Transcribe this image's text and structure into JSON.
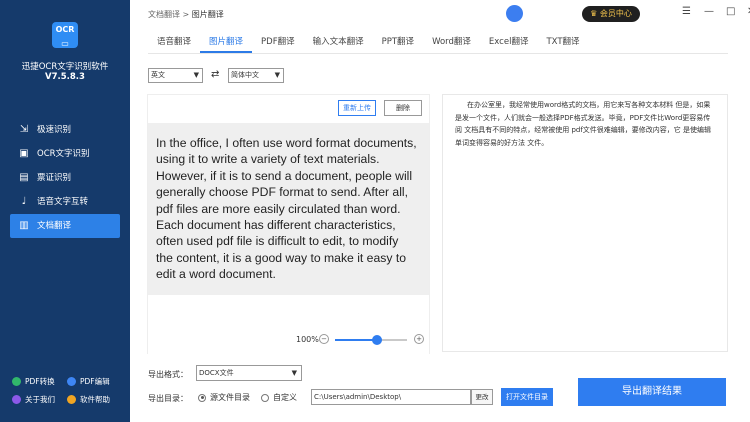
{
  "app": {
    "name": "迅捷OCR文字识别软件",
    "version": "V7.5.8.3"
  },
  "sidebar": {
    "items": [
      {
        "label": "极速识别",
        "icon": "speed-icon"
      },
      {
        "label": "OCR文字识别",
        "icon": "scan-icon"
      },
      {
        "label": "票证识别",
        "icon": "ticket-icon"
      },
      {
        "label": "语音文字互转",
        "icon": "mic-icon"
      },
      {
        "label": "文档翻译",
        "icon": "doc-icon"
      }
    ],
    "active_index": 4,
    "bottom": [
      "PDF转换",
      "PDF编辑",
      "关于我们",
      "软件帮助"
    ]
  },
  "topbar": {
    "breadcrumb": [
      "文档翻译",
      "图片翻译"
    ],
    "vip_label": "会员中心"
  },
  "tabs": [
    "语音翻译",
    "图片翻译",
    "PDF翻译",
    "输入文本翻译",
    "PPT翻译",
    "Word翻译",
    "Excel翻译",
    "TXT翻译"
  ],
  "active_tab": 1,
  "languages": {
    "source": "英文",
    "target": "简体中文"
  },
  "buttons": {
    "reupload": "重新上传",
    "delete": "删除",
    "change": "更改",
    "open_folder": "打开文件目录",
    "export": "导出翻译结果"
  },
  "source_text": "In the office, I often use word format documents, using it to write a variety of text materials. However, if it is to send a document, people will generally choose PDF format to send. After all, pdf files are more easily circulated than word. Each document has different characteristics, often used pdf file is difficult to edit, to modify the content, it is a good way to make it easy to edit a word document.",
  "target_text": "在办公室里，我经常使用word格式的文档，用它来写各种文本材料 但是，如果是发一个文件，人们就会一般选择PDF格式发送。毕竟，PDF文件比Word更容易传阅 文档具有不同的特点，经常被使用 pdf文件很难编辑，要修改内容，它 是使编辑单词变得容易的好方法 文件。",
  "zoom": {
    "label": "100%",
    "level": 0.58
  },
  "export": {
    "format_label": "导出格式：",
    "format_value": "DOCX文件",
    "dir_label": "导出目录：",
    "radio_source": "源文件目录",
    "radio_custom": "自定义",
    "path": "C:\\Users\\admin\\Desktop\\"
  }
}
